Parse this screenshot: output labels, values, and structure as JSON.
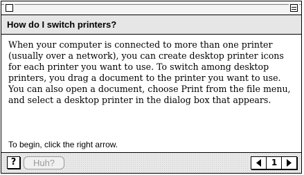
{
  "window": {
    "question": "How do I switch printers?",
    "body_paragraph": "When your computer is connected to more than one printer (usually over a network), you can create desktop printer icons for each printer you want to use. To switch among desktop printers, you drag a document to the printer you want to use. You can also open a document, choose Print from the file menu, and select a desktop printer in the dialog box that appears.",
    "instruction": "To begin, click the right arrow."
  },
  "bottombar": {
    "help_label": "?",
    "huh_label": "Huh?",
    "page_number": "1"
  },
  "icons": {
    "close": "close-box-icon",
    "collapse": "collapse-box-icon",
    "prev": "left-arrow-icon",
    "next": "right-arrow-icon"
  }
}
